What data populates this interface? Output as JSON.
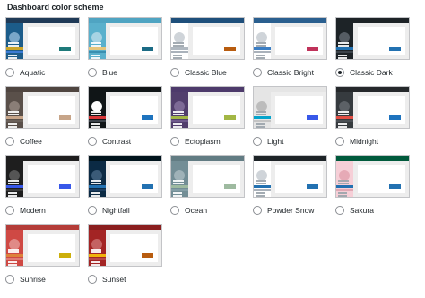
{
  "heading": "Dashboard color scheme",
  "selected": "Classic Dark",
  "schemes": [
    {
      "name": "Aquatic",
      "top": "#1f3a57",
      "side": "#1c5c8a",
      "avatar": "#7aa7c9",
      "hl": "#c9a429",
      "hl2": "#3a7bd5",
      "btn": "#1e7a7a",
      "checked": false
    },
    {
      "name": "Blue",
      "top": "#4fa4c2",
      "side": "#5ab0cc",
      "avatar": "#a7d3e3",
      "hl": "#e6c57a",
      "hl2": "#3a8fb0",
      "btn": "#1b6b85",
      "checked": false
    },
    {
      "name": "Classic Blue",
      "top": "#1e4f7b",
      "side": "#ffffff",
      "avatar": "#cfd4d9",
      "hl": "#b0b8c0",
      "hl2": "#aab2bb",
      "btn": "#b85c0f",
      "checked": false
    },
    {
      "name": "Classic Bright",
      "top": "#2a5f8f",
      "side": "#ffffff",
      "avatar": "#cfd4d9",
      "hl": "#3b7ec4",
      "hl2": "#aab2bb",
      "btn": "#c0325a",
      "checked": false
    },
    {
      "name": "Classic Dark",
      "top": "#1d2327",
      "side": "#1d2327",
      "avatar": "#555c63",
      "hl": "#2271b1",
      "hl2": "#3c434a",
      "btn": "#2271b1",
      "checked": true
    },
    {
      "name": "Coffee",
      "top": "#4f4540",
      "side": "#5a504a",
      "avatar": "#8a7e77",
      "hl": "#c7a589",
      "hl2": "#6b615a",
      "btn": "#c7a589",
      "checked": false
    },
    {
      "name": "Contrast",
      "top": "#101517",
      "side": "#101517",
      "avatar": "#ffffff",
      "hl": "#d63638",
      "hl2": "#3c434a",
      "btn": "#1e73be",
      "checked": false
    },
    {
      "name": "Ectoplasm",
      "top": "#4d3a6b",
      "side": "#523f6d",
      "avatar": "#7d6a96",
      "hl": "#a3b745",
      "hl2": "#6f5a8c",
      "btn": "#a3b745",
      "checked": false
    },
    {
      "name": "Light",
      "top": "#e5e5e5",
      "side": "#e5e5e5",
      "avatar": "#bcbcbc",
      "hl": "#04a4cc",
      "hl2": "#c4c4c4",
      "btn": "#3858e9",
      "checked": false
    },
    {
      "name": "Midnight",
      "top": "#25282b",
      "side": "#363b3f",
      "avatar": "#5c6166",
      "hl": "#e14d43",
      "hl2": "#4a4f54",
      "btn": "#1e73be",
      "checked": false
    },
    {
      "name": "Modern",
      "top": "#1e1e1e",
      "side": "#1e1e1e",
      "avatar": "#555555",
      "hl": "#3858e9",
      "hl2": "#3c3c3c",
      "btn": "#3858e9",
      "checked": false
    },
    {
      "name": "Nightfall",
      "top": "#00131c",
      "side": "#0b2a44",
      "avatar": "#3b5b78",
      "hl": "#2271b1",
      "hl2": "#1c3d5e",
      "btn": "#2271b1",
      "checked": false
    },
    {
      "name": "Ocean",
      "top": "#627c83",
      "side": "#738e96",
      "avatar": "#9fb2b8",
      "hl": "#9ebaa0",
      "hl2": "#849ea6",
      "btn": "#9ebaa0",
      "checked": false
    },
    {
      "name": "Powder Snow",
      "top": "#1d2327",
      "side": "#ffffff",
      "avatar": "#cfd4d9",
      "hl": "#2271b1",
      "hl2": "#aab2bb",
      "btn": "#2271b1",
      "checked": false
    },
    {
      "name": "Sakura",
      "top": "#005a3c",
      "side": "#f6cfd7",
      "avatar": "#e6aab6",
      "hl": "#2271b1",
      "hl2": "#e0a8b4",
      "btn": "#2271b1",
      "checked": false
    },
    {
      "name": "Sunrise",
      "top": "#b43c38",
      "side": "#cf4944",
      "avatar": "#e08a87",
      "hl": "#dd823b",
      "hl2": "#e07a75",
      "btn": "#ccaf0b",
      "checked": false
    },
    {
      "name": "Sunset",
      "top": "#8a1e1e",
      "side": "#a32424",
      "avatar": "#c46363",
      "hl": "#f0b30a",
      "hl2": "#b84848",
      "btn": "#b85c0f",
      "checked": false
    }
  ]
}
